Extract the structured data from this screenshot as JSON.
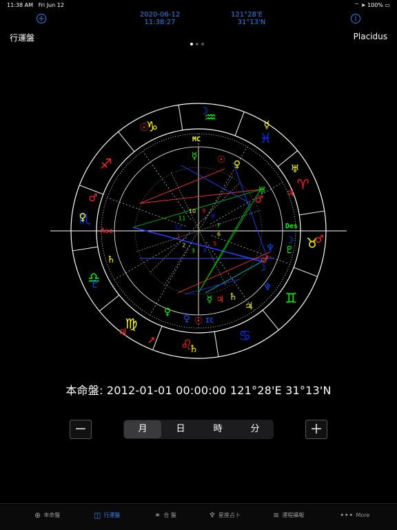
{
  "status": {
    "time": "11:38 AM",
    "date": "Fri Jun 12",
    "battery": "100%"
  },
  "header": {
    "datetime_date": "2020-06-12",
    "datetime_time": "11:38:27",
    "lon": "121°28'E",
    "lat": "31°13'N",
    "add_icon": "+",
    "info_icon": "i",
    "title_left": "行運盤",
    "title_right": "Placidus"
  },
  "chart": {
    "sign_glyphs": [
      "♈",
      "♉",
      "♊",
      "♋",
      "♌",
      "♍",
      "♎",
      "♏",
      "♐",
      "♑",
      "♒",
      "♓"
    ],
    "angle_labels": {
      "asc": "Asc",
      "mc": "MC",
      "ic": "IC",
      "des": "Des"
    },
    "house_numbers": [
      "1",
      "2",
      "3",
      "4",
      "5",
      "6",
      "7",
      "8",
      "9",
      "10",
      "11",
      "12"
    ],
    "colors": {
      "fire": "#ff2020",
      "earth": "#ffff00",
      "air": "#00ff00",
      "water": "#0030ff"
    }
  },
  "natal_caption": "本命盤: 2012-01-01 00:00:00 121°28'E 31°13'N",
  "controls": {
    "minus": "−",
    "plus": "+",
    "segments": [
      {
        "label": "月",
        "selected": true
      },
      {
        "label": "日",
        "selected": false
      },
      {
        "label": "時",
        "selected": false
      },
      {
        "label": "分",
        "selected": false
      }
    ]
  },
  "tabs": [
    {
      "label": "本命盤",
      "icon": "⊕",
      "active": false
    },
    {
      "label": "行運盤",
      "icon": "◫",
      "active": true
    },
    {
      "label": "合 盤",
      "icon": "⚭",
      "active": false
    },
    {
      "label": "星座占卜",
      "icon": "♆",
      "active": false
    },
    {
      "label": "運程攝報",
      "icon": "≋",
      "active": false
    },
    {
      "label": "More",
      "icon": "•••",
      "active": false
    }
  ]
}
